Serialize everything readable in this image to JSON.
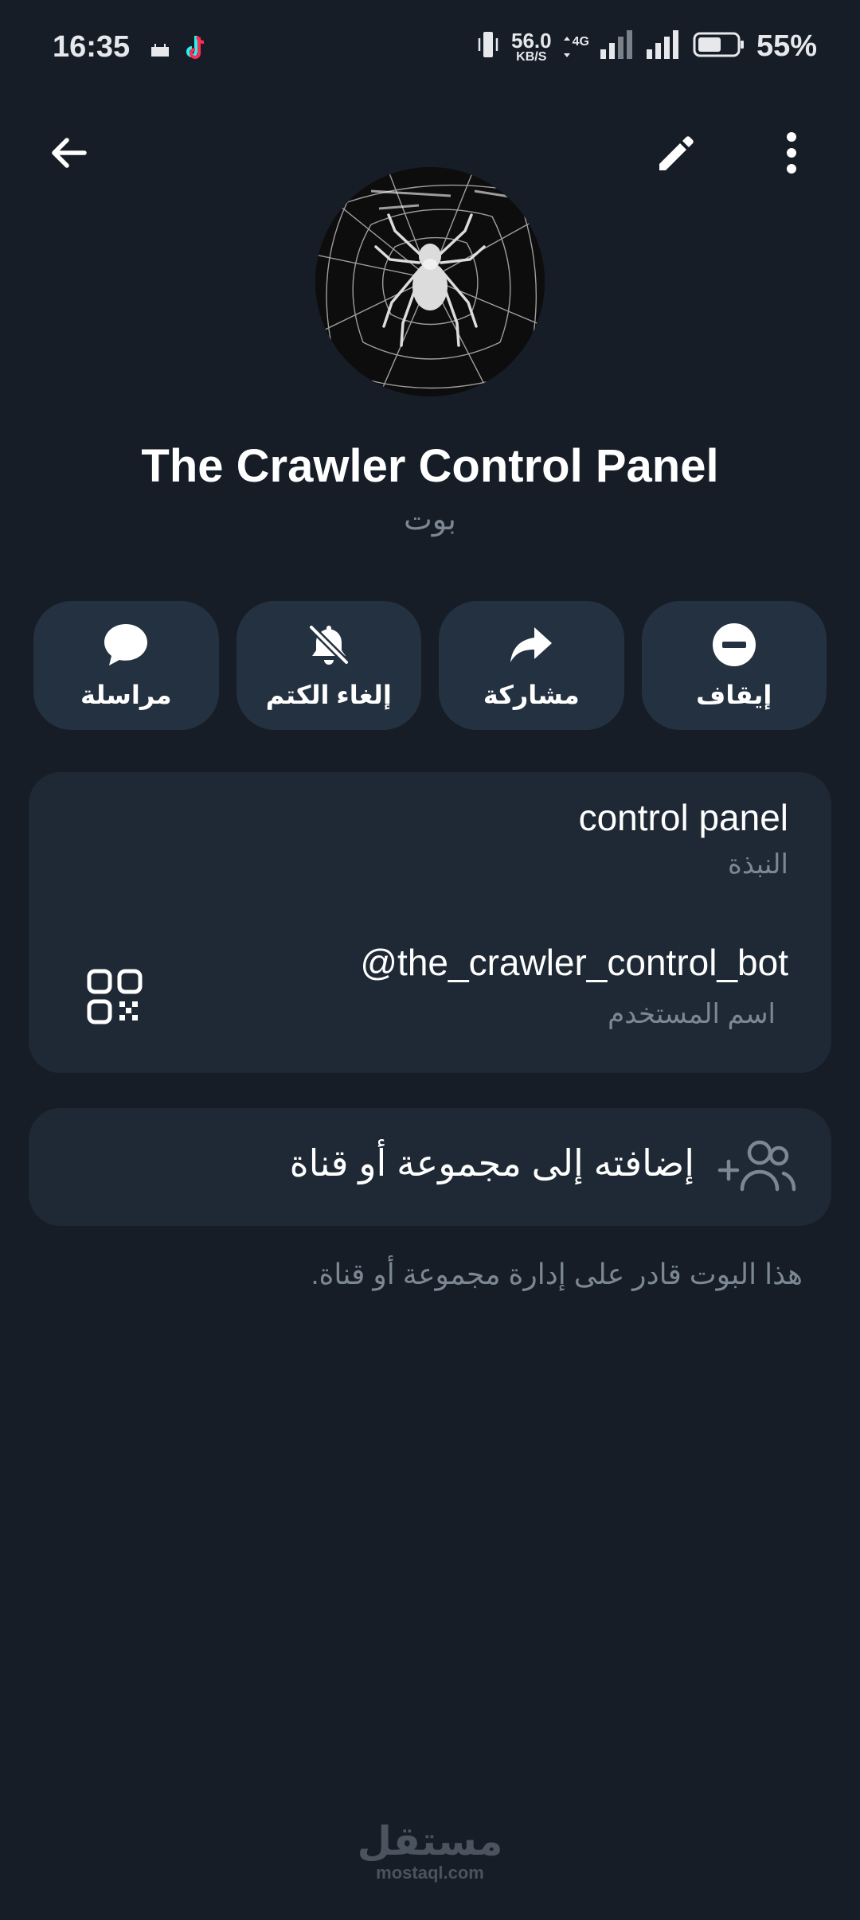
{
  "status_bar": {
    "time": "16:35",
    "net_speed_value": "56.0",
    "net_speed_unit": "KB/S",
    "network_type": "4G",
    "battery_percent": "55%",
    "icons": [
      "mosque-notification-icon",
      "tiktok-notification-icon",
      "vibrate-icon",
      "data-arrows-icon",
      "signal-icon",
      "signal-icon",
      "battery-icon"
    ]
  },
  "top_bar": {
    "icons": [
      "back-arrow-icon",
      "pencil-icon",
      "more-vertical-icon"
    ]
  },
  "profile": {
    "name": "The Crawler Control Panel",
    "subtitle": "بوت"
  },
  "actions": [
    {
      "label": "مراسلة",
      "icon": "chat-bubble-icon"
    },
    {
      "label": "إلغاء الكتم",
      "icon": "bell-off-icon"
    },
    {
      "label": "مشاركة",
      "icon": "share-arrow-icon"
    },
    {
      "label": "إيقاف",
      "icon": "block-icon"
    }
  ],
  "info": {
    "bio_value": "control panel",
    "bio_label": "النبذة",
    "username_value": "@the_crawler_control_bot",
    "username_label": "اسم المستخدم",
    "qr_icon": "qr-code-icon"
  },
  "add_to_group": {
    "label": "إضافته إلى مجموعة أو قناة",
    "icon": "add-users-icon"
  },
  "hint": "هذا البوت قادر على إدارة مجموعة أو قناة.",
  "watermark": {
    "brand": "مستقل",
    "url": "mostaql.com"
  },
  "colors": {
    "background": "#161d27",
    "card": "#1f2935",
    "action_button": "#243140",
    "secondary_text": "#7c8794",
    "primary_text": "#ffffff"
  }
}
